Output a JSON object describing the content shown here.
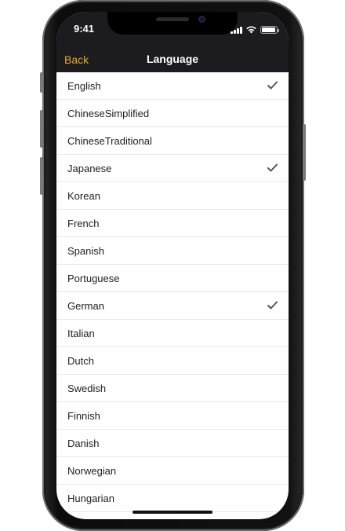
{
  "status_bar": {
    "time": "9:41"
  },
  "nav": {
    "back_label": "Back",
    "title": "Language"
  },
  "colors": {
    "accent": "#e8a72a",
    "header_bg": "#1c1c1e",
    "check": "#555555"
  },
  "icons": {
    "selected": "checkmark-icon"
  },
  "languages": [
    {
      "label": "English",
      "selected": true
    },
    {
      "label": "ChineseSimplified",
      "selected": false
    },
    {
      "label": "ChineseTraditional",
      "selected": false
    },
    {
      "label": "Japanese",
      "selected": true
    },
    {
      "label": "Korean",
      "selected": false
    },
    {
      "label": "French",
      "selected": false
    },
    {
      "label": "Spanish",
      "selected": false
    },
    {
      "label": "Portuguese",
      "selected": false
    },
    {
      "label": "German",
      "selected": true
    },
    {
      "label": "Italian",
      "selected": false
    },
    {
      "label": "Dutch",
      "selected": false
    },
    {
      "label": "Swedish",
      "selected": false
    },
    {
      "label": "Finnish",
      "selected": false
    },
    {
      "label": "Danish",
      "selected": false
    },
    {
      "label": "Norwegian",
      "selected": false
    },
    {
      "label": "Hungarian",
      "selected": false
    }
  ]
}
